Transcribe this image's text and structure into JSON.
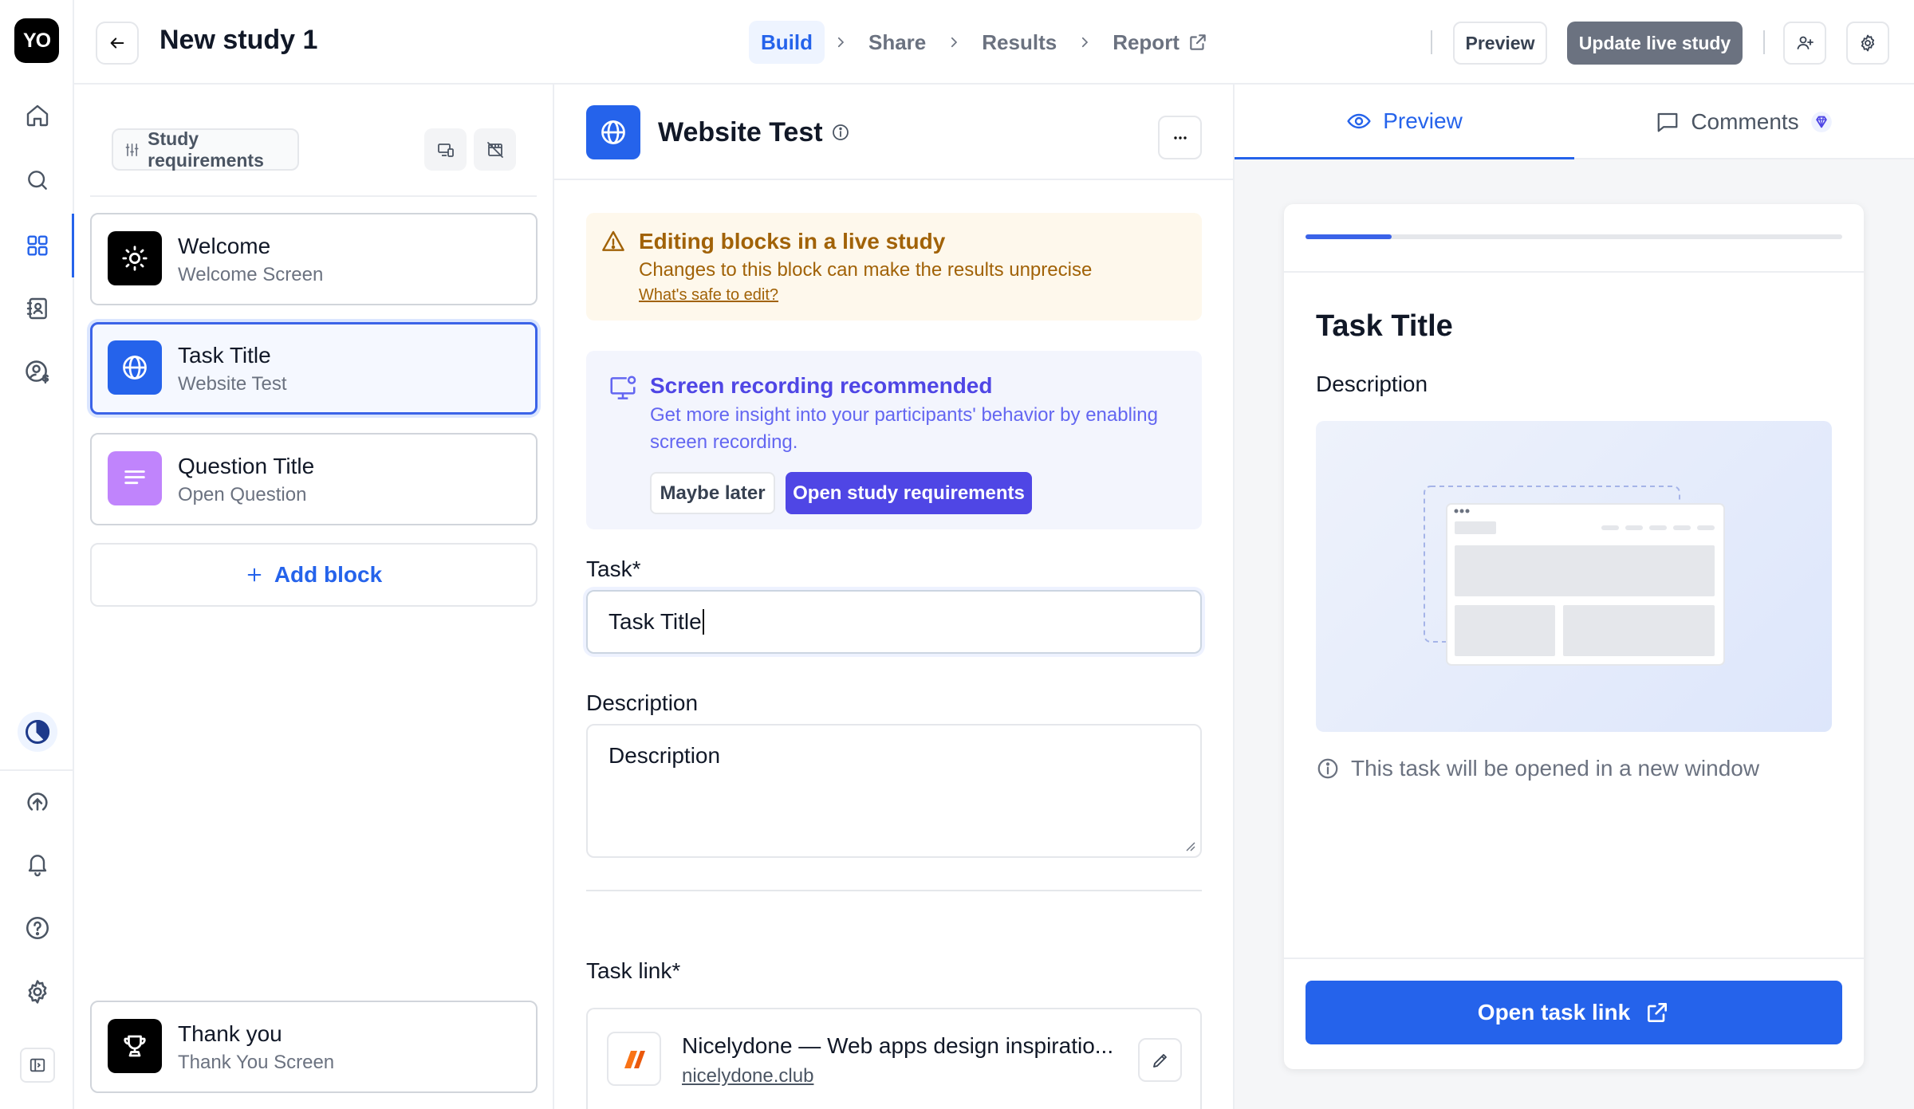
{
  "app": {
    "logo_text": "YO"
  },
  "rail": {
    "top_items": [
      "home-icon",
      "search-icon",
      "grid-icon",
      "contacts-icon",
      "user-dollar-icon"
    ],
    "bottom_items": [
      "chart-pie-icon",
      "upload-cloud-icon",
      "bell-icon",
      "help-icon",
      "gear-icon",
      "sidebar-toggle-icon"
    ],
    "active": "grid-icon"
  },
  "header": {
    "study_title": "New study 1",
    "steps": [
      {
        "label": "Build",
        "active": true
      },
      {
        "label": "Share",
        "active": false
      },
      {
        "label": "Results",
        "active": false
      },
      {
        "label": "Report",
        "active": false,
        "external": true
      }
    ],
    "preview_label": "Preview",
    "update_label": "Update live study"
  },
  "blocks": {
    "requirements_label": "Study requirements",
    "items": [
      {
        "title": "Welcome",
        "subtitle": "Welcome Screen",
        "icon": "sun-icon",
        "color": "#000000"
      },
      {
        "title": "Task Title",
        "subtitle": "Website Test",
        "icon": "globe-icon",
        "color": "#2563eb",
        "selected": true
      },
      {
        "title": "Question Title",
        "subtitle": "Open Question",
        "icon": "text-lines-icon",
        "color": "#c084fc"
      }
    ],
    "add_label": "Add block",
    "final": {
      "title": "Thank you",
      "subtitle": "Thank You Screen",
      "icon": "trophy-icon",
      "color": "#000000"
    }
  },
  "editor": {
    "title": "Website Test",
    "warning": {
      "title": "Editing blocks in a live study",
      "text": "Changes to this block can make the results unprecise",
      "link": "What's safe to edit?"
    },
    "recording": {
      "title": "Screen recording recommended",
      "text": "Get more insight into your participants' behavior by enabling screen recording.",
      "later_label": "Maybe later",
      "open_label": "Open study requirements"
    },
    "task_label": "Task*",
    "task_value": "Task Title",
    "description_label": "Description",
    "description_value": "Description",
    "task_link_label": "Task link*",
    "link": {
      "title": "Nicelydone — Web apps design inspiratio...",
      "url": "nicelydone.club"
    }
  },
  "preview": {
    "tabs": [
      {
        "label": "Preview",
        "active": true
      },
      {
        "label": "Comments",
        "active": false
      }
    ],
    "progress_fraction": 0.16,
    "title": "Task Title",
    "description": "Description",
    "note": "This task will be opened in a new window",
    "open_label": "Open task link"
  },
  "colors": {
    "accent": "#2563eb",
    "warning_text": "#a16207",
    "warning_bg": "#fef8ec",
    "indigo": "#4f46e5",
    "update_button": "#6b7280"
  }
}
